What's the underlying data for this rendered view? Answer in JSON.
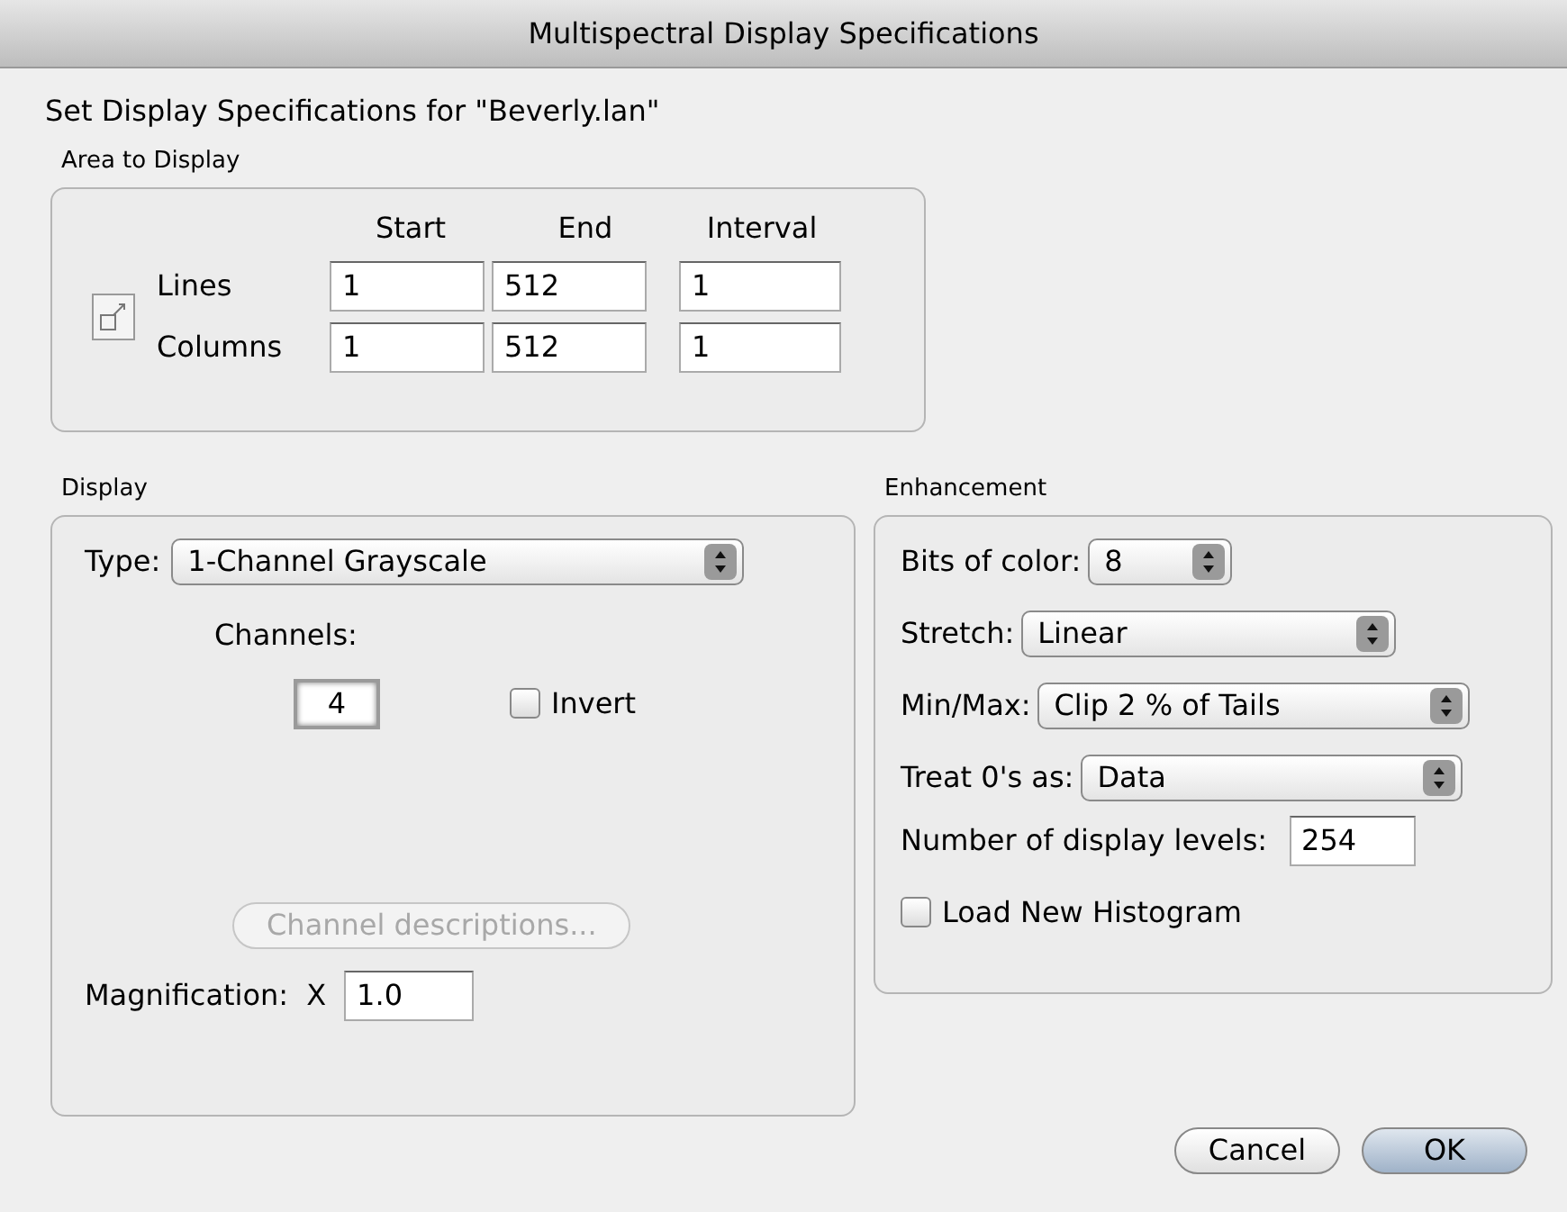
{
  "window": {
    "title": "Multispectral Display Specifications"
  },
  "heading": "Set Display Specifications for \"Beverly.lan\"",
  "area": {
    "title": "Area to Display",
    "columns": [
      "Start",
      "End",
      "Interval"
    ],
    "rows": [
      {
        "label": "Lines",
        "values": [
          "1",
          "512",
          "1"
        ]
      },
      {
        "label": "Columns",
        "values": [
          "1",
          "512",
          "1"
        ]
      }
    ]
  },
  "display": {
    "title": "Display",
    "type_label": "Type:",
    "type_value": "1-Channel Grayscale",
    "channels_label": "Channels:",
    "channel_value": "4",
    "invert": {
      "label": "Invert",
      "checked": false
    },
    "channel_desc_button": {
      "label": "Channel descriptions...",
      "disabled": true
    },
    "magnification_label": "Magnification:",
    "magnification_axis": "X",
    "magnification_value": "1.0"
  },
  "enhancement": {
    "title": "Enhancement",
    "bits": {
      "label": "Bits of color:",
      "value": "8"
    },
    "selects": [
      {
        "label": "Stretch:",
        "value": "Linear"
      },
      {
        "label": "Min/Max:",
        "value": "Clip 2 % of Tails"
      },
      {
        "label": "Treat 0's as:",
        "value": "Data"
      }
    ],
    "levels": {
      "label": "Number of display levels:",
      "value": "254"
    },
    "load_histogram": {
      "label": "Load New Histogram",
      "checked": false
    }
  },
  "buttons": [
    {
      "label": "Cancel",
      "default": false
    },
    {
      "label": "OK",
      "default": true
    }
  ]
}
